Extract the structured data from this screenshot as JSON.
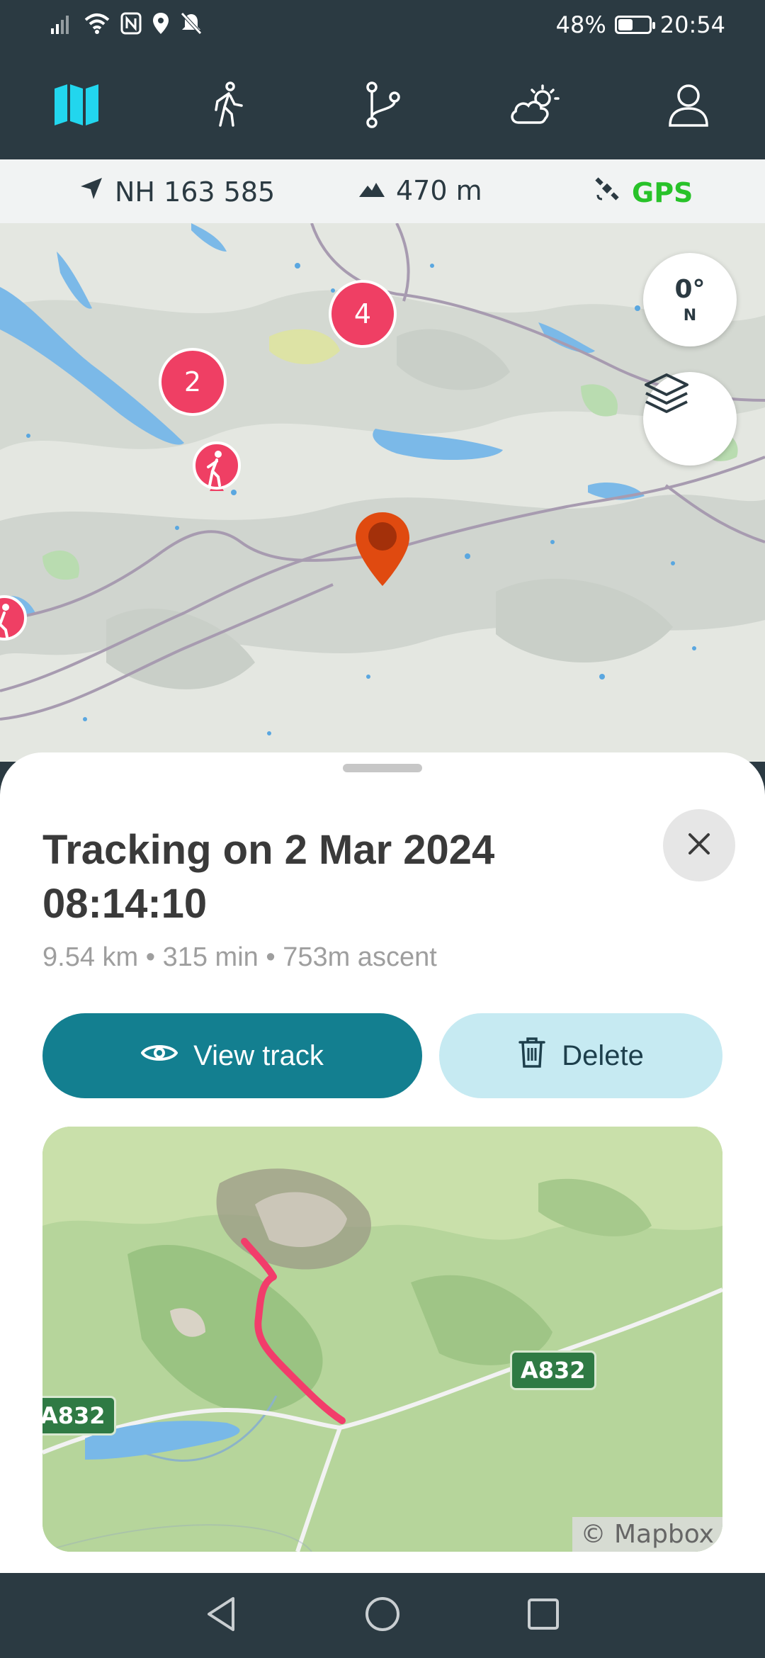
{
  "status_bar": {
    "battery_level": "48%",
    "battery_fraction": 0.48,
    "time": "20:54",
    "icons": [
      "signal-icon",
      "wifi-icon",
      "nfc-icon",
      "location-icon",
      "silent-icon"
    ]
  },
  "top_nav": {
    "items": [
      {
        "name": "map",
        "icon": "map-icon",
        "active": true
      },
      {
        "name": "hike",
        "icon": "walker-icon",
        "active": false
      },
      {
        "name": "routes",
        "icon": "route-branch-icon",
        "active": false
      },
      {
        "name": "weather",
        "icon": "weather-icon",
        "active": false
      },
      {
        "name": "profile",
        "icon": "user-icon",
        "active": false
      }
    ]
  },
  "info_bar": {
    "grid_ref": "NH 163 585",
    "altitude": "470 m",
    "gps_label": "GPS",
    "gps_color": "#28c229"
  },
  "map": {
    "compass_degrees": "0°",
    "compass_direction": "N",
    "clusters": [
      {
        "count": "2"
      },
      {
        "count": "4"
      }
    ],
    "marker_color": "#e04a10",
    "cluster_color": "#ef3f64"
  },
  "sheet": {
    "title": "Tracking on 2 Mar 2024 08:14:10",
    "stats": "9.54 km • 315 min • 753m ascent",
    "view_track_label": "View track",
    "delete_label": "Delete",
    "preview": {
      "road_labels": [
        "A832",
        "A832"
      ],
      "attribution": "© Mapbox",
      "track_color": "#f23d6b"
    }
  },
  "colors": {
    "primary": "#137f90",
    "secondary": "#c6eaf2",
    "nav_background": "#2b3a42",
    "accent_active": "#22d6ee"
  }
}
